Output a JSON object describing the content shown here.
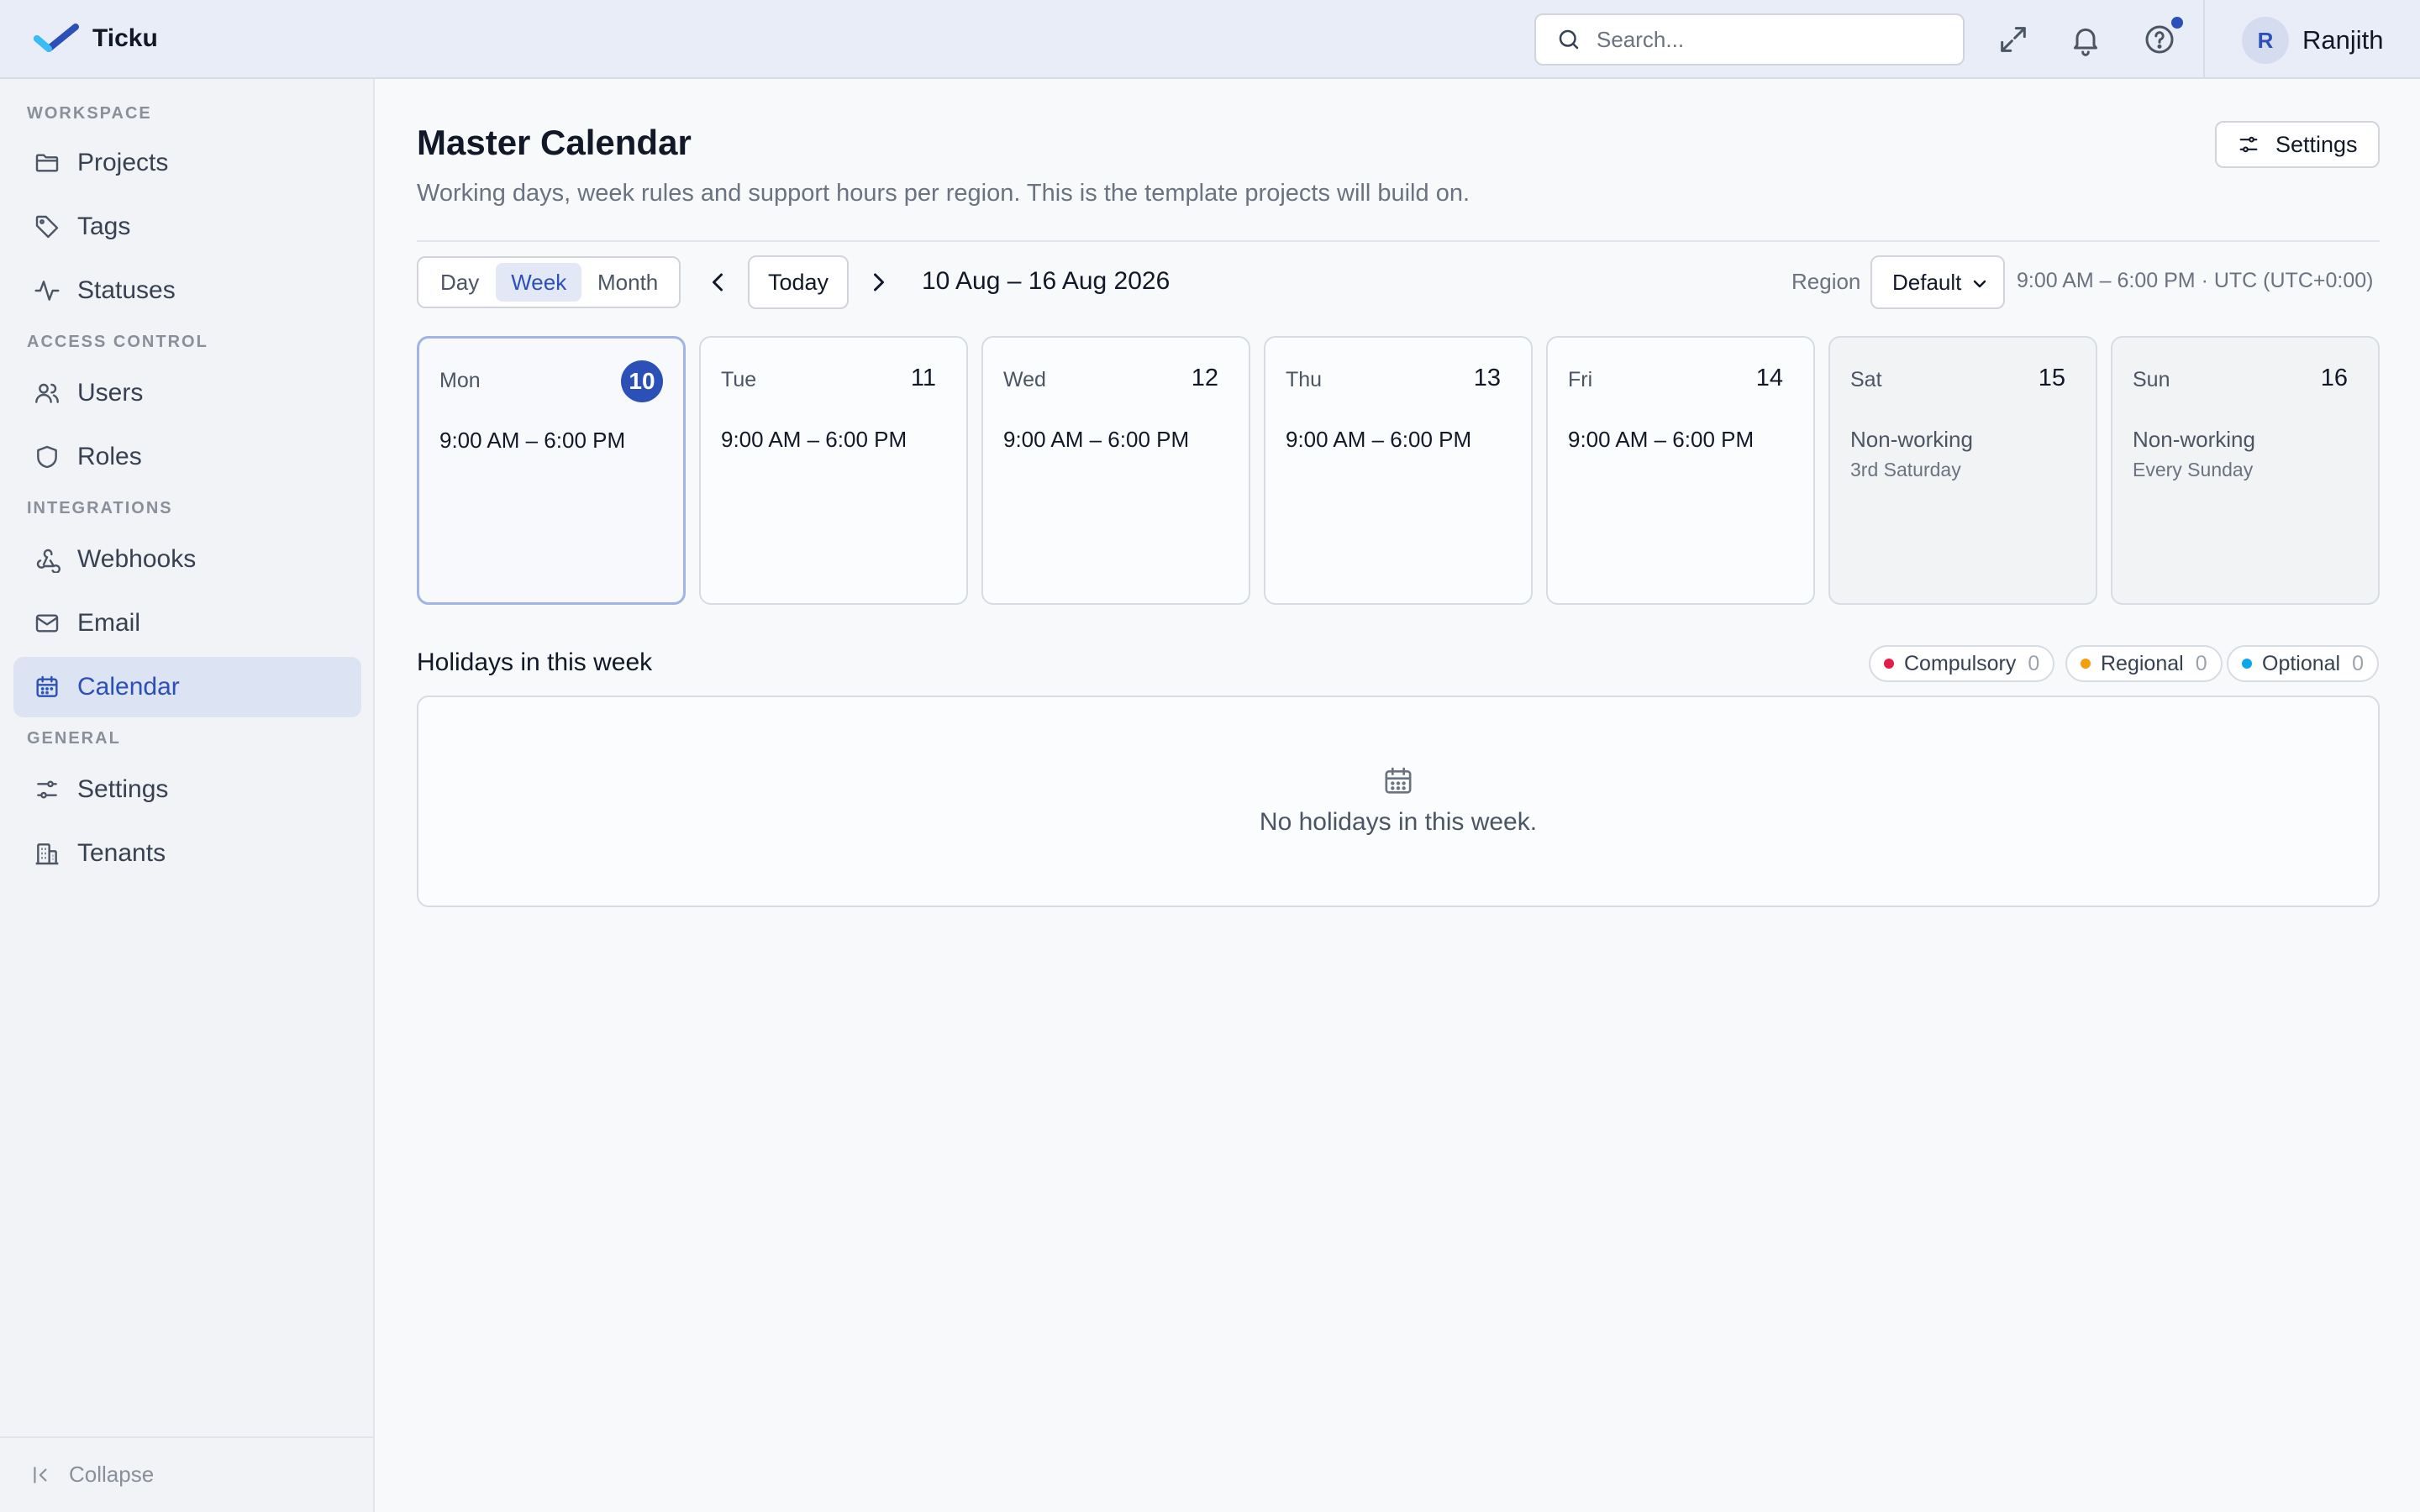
{
  "app": {
    "name": "Ticku"
  },
  "header": {
    "search_placeholder": "Search...",
    "user": {
      "initial": "R",
      "name": "Ranjith"
    },
    "accent": "#2b50b8"
  },
  "sidebar": {
    "sections": [
      {
        "label": "WORKSPACE"
      },
      {
        "label": "ACCESS CONTROL"
      },
      {
        "label": "INTEGRATIONS"
      },
      {
        "label": "GENERAL"
      }
    ],
    "items": [
      {
        "label": "Projects",
        "icon": "folder-icon"
      },
      {
        "label": "Tags",
        "icon": "tag-icon"
      },
      {
        "label": "Statuses",
        "icon": "activity-icon"
      },
      {
        "label": "Users",
        "icon": "users-icon"
      },
      {
        "label": "Roles",
        "icon": "shield-icon"
      },
      {
        "label": "Webhooks",
        "icon": "webhook-icon"
      },
      {
        "label": "Email",
        "icon": "mail-icon"
      },
      {
        "label": "Calendar",
        "icon": "calendar-icon",
        "active": true
      },
      {
        "label": "Settings",
        "icon": "sliders-icon"
      },
      {
        "label": "Tenants",
        "icon": "building-icon"
      }
    ],
    "collapse_label": "Collapse"
  },
  "main": {
    "title": "Master Calendar",
    "subtitle": "Working days, week rules and support hours per region. This is the template projects will build on.",
    "settings_label": "Settings",
    "views": [
      "Day",
      "Week",
      "Month"
    ],
    "active_view": "Week",
    "today_label": "Today",
    "date_range": "10 Aug – 16 Aug 2026",
    "region_label": "Region",
    "region_value": "Default",
    "hours_info": "9:00 AM – 6:00 PM · UTC (UTC+0:00)",
    "days": [
      {
        "name": "Mon",
        "num": "10",
        "hours": "9:00 AM – 6:00 PM",
        "today": true
      },
      {
        "name": "Tue",
        "num": "11",
        "hours": "9:00 AM – 6:00 PM"
      },
      {
        "name": "Wed",
        "num": "12",
        "hours": "9:00 AM – 6:00 PM"
      },
      {
        "name": "Thu",
        "num": "13",
        "hours": "9:00 AM – 6:00 PM"
      },
      {
        "name": "Fri",
        "num": "14",
        "hours": "9:00 AM – 6:00 PM"
      },
      {
        "name": "Sat",
        "num": "15",
        "status": "Non-working",
        "note": "3rd Saturday"
      },
      {
        "name": "Sun",
        "num": "16",
        "status": "Non-working",
        "note": "Every Sunday"
      }
    ],
    "holidays": {
      "title": "Holidays in this week",
      "legend": [
        {
          "label": "Compulsory",
          "count": "0",
          "color": "#e11d48"
        },
        {
          "label": "Regional",
          "count": "0",
          "color": "#f59e0b"
        },
        {
          "label": "Optional",
          "count": "0",
          "color": "#0ea5e9"
        }
      ],
      "empty_text": "No holidays in this week."
    }
  }
}
